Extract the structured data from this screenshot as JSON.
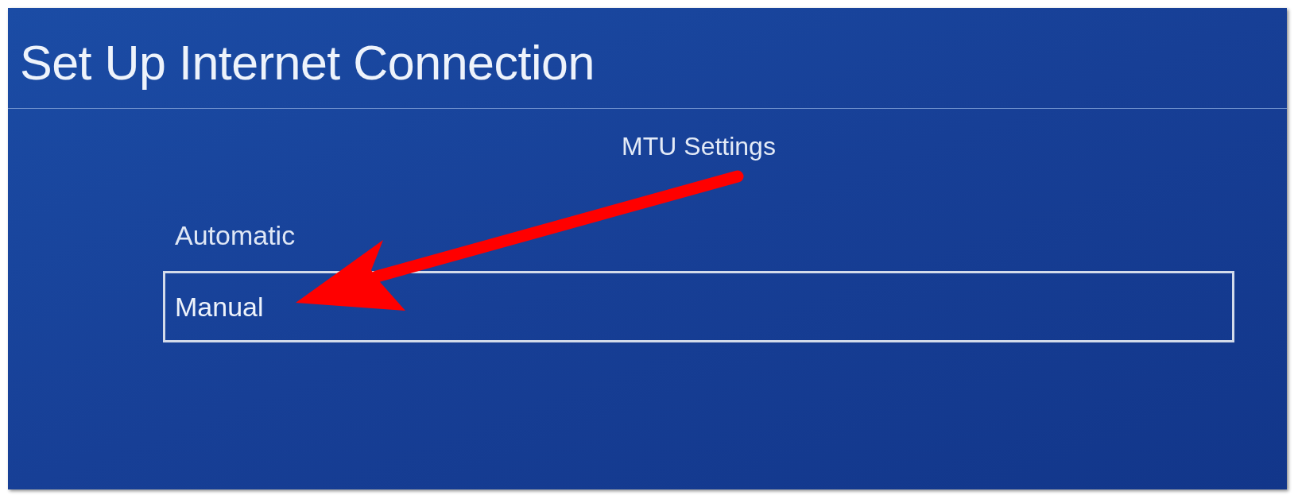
{
  "header": {
    "title": "Set Up Internet Connection"
  },
  "list": {
    "title": "MTU Settings",
    "items": [
      {
        "label": "Automatic",
        "selected": false
      },
      {
        "label": "Manual",
        "selected": true
      }
    ]
  }
}
